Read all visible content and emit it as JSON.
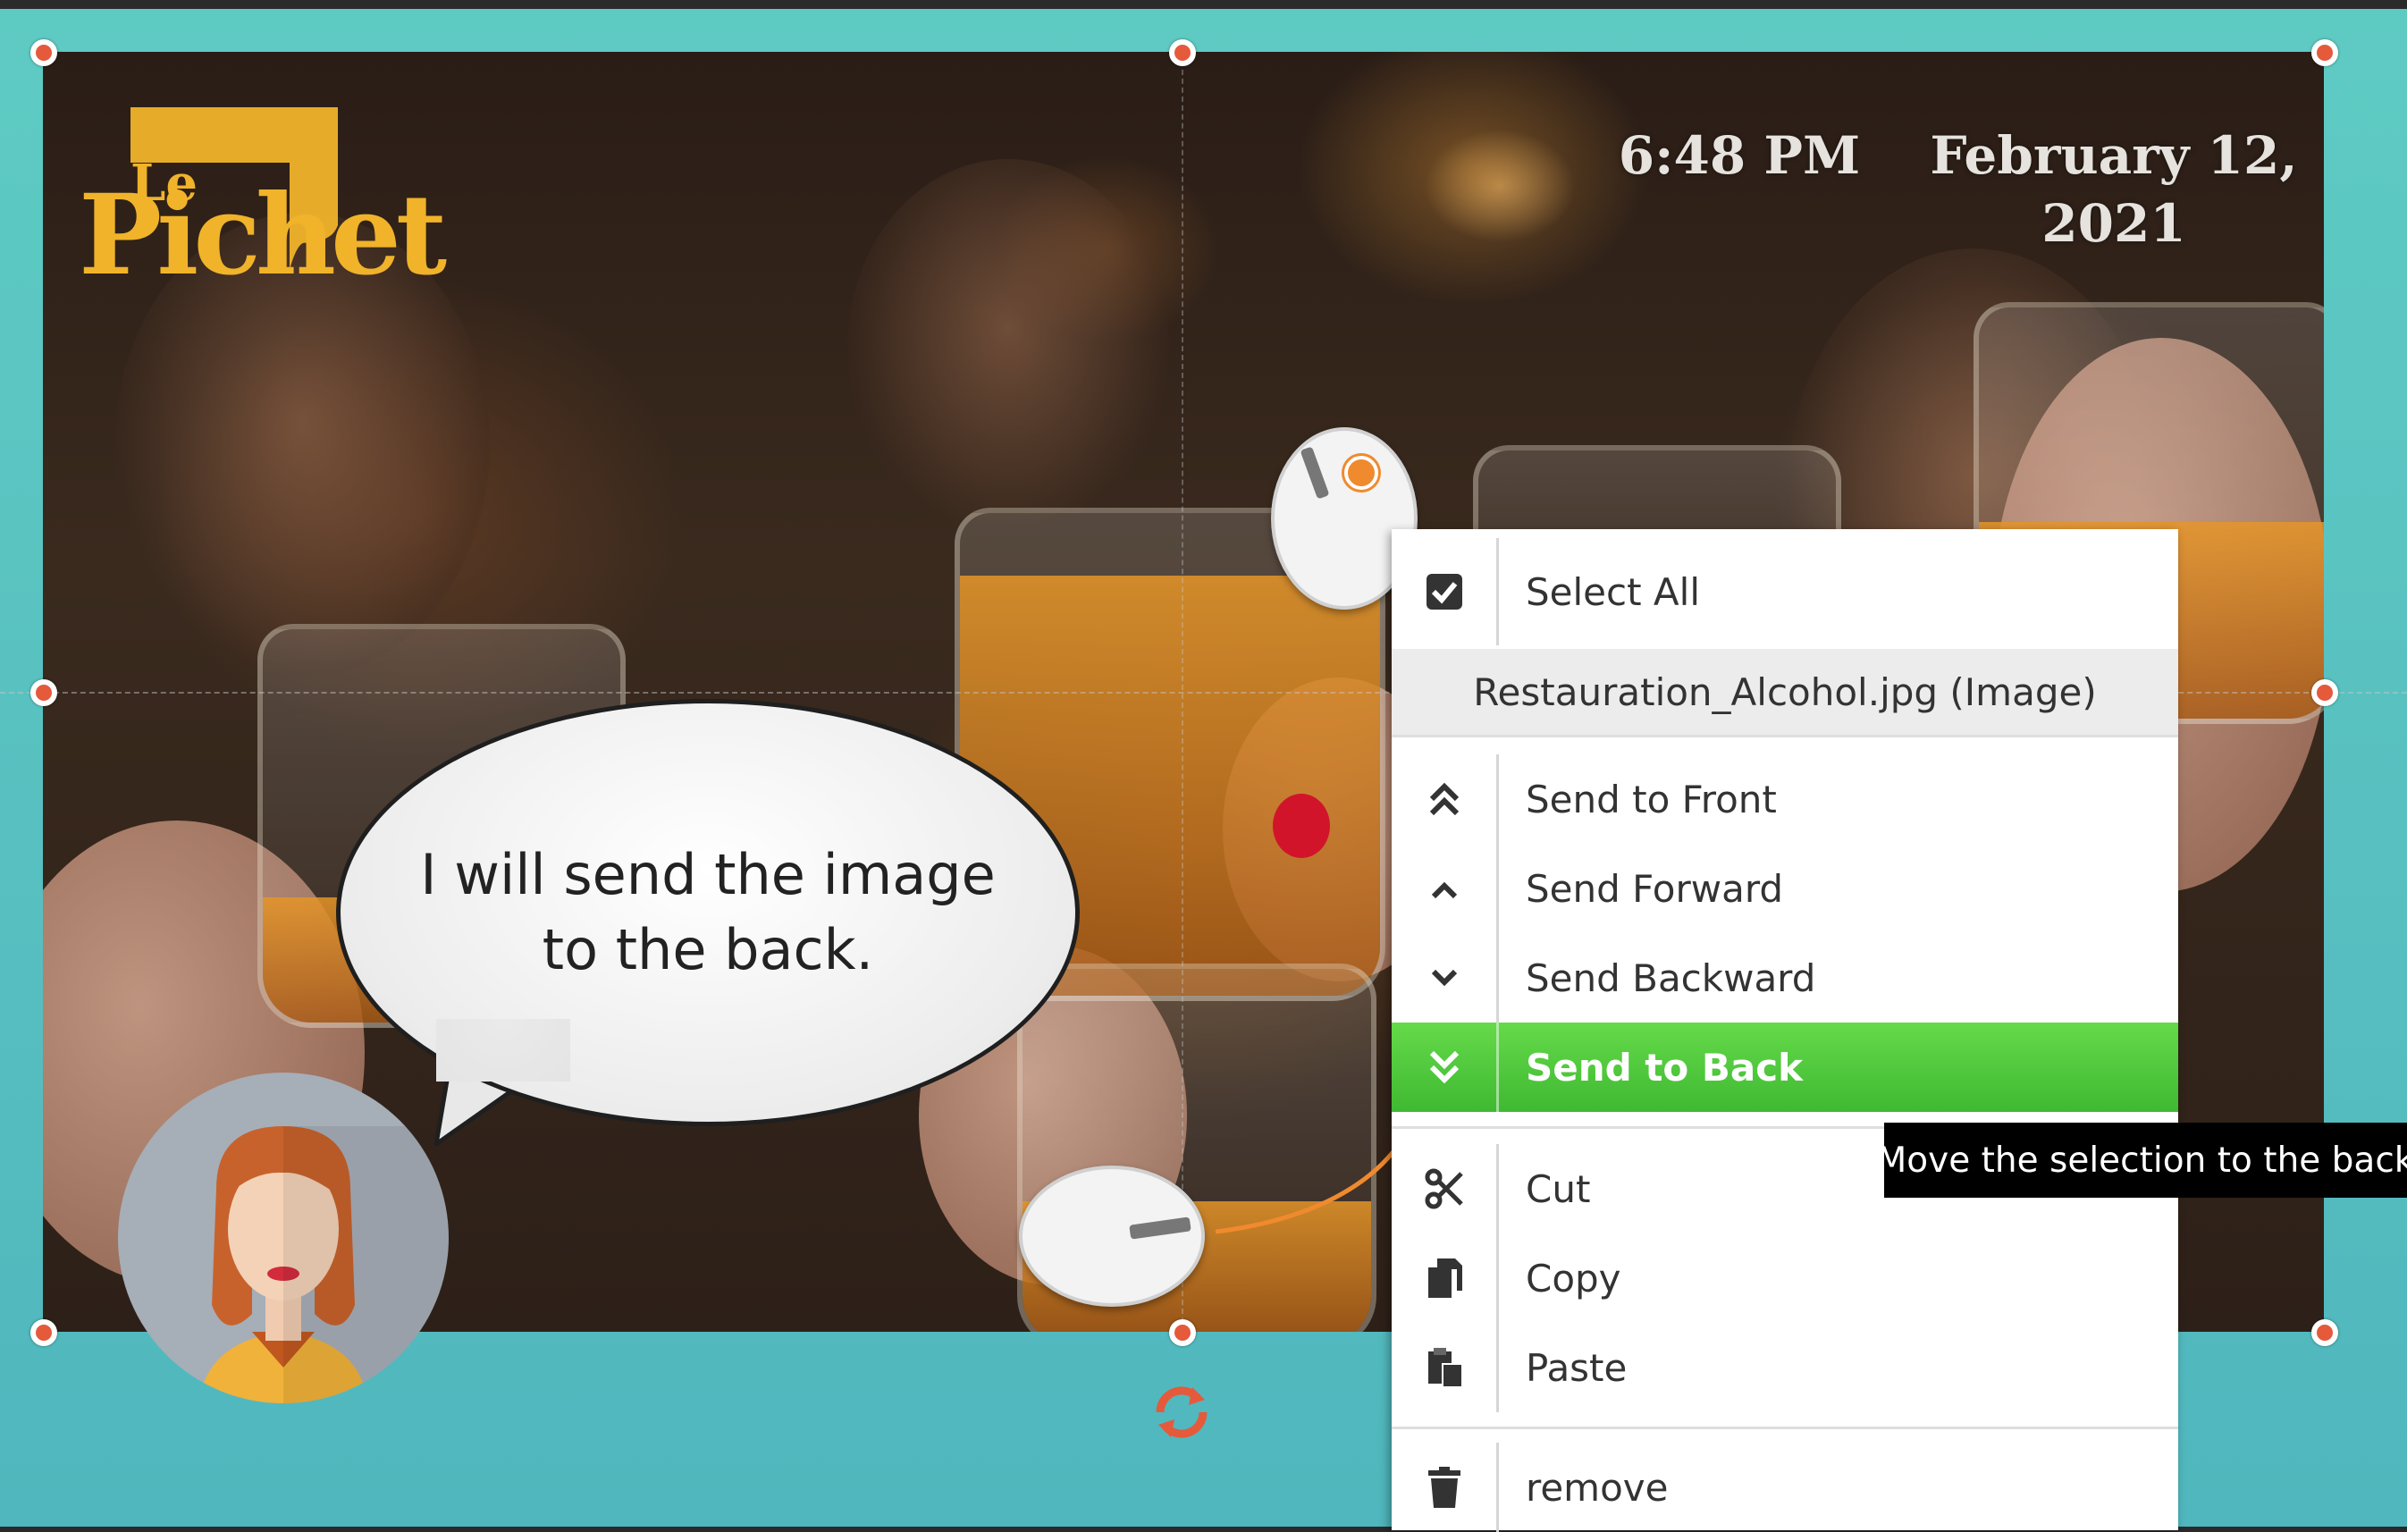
{
  "logo": {
    "prefix": "Le",
    "name": "Pichet"
  },
  "clock": {
    "time": "6:48 PM",
    "date_line1": "February 12,",
    "date_line2": "2021"
  },
  "bubble": {
    "text": "I will send the image to the back."
  },
  "menu": {
    "select_all": "Select All",
    "header": "Restauration_Alcohol.jpg (Image)",
    "send_to_front": "Send to Front",
    "send_forward": "Send Forward",
    "send_backward": "Send Backward",
    "send_to_back": "Send to Back",
    "cut": "Cut",
    "copy": "Copy",
    "paste": "Paste",
    "remove": "remove"
  },
  "tooltip": {
    "text": "Move the selection to the back"
  },
  "colors": {
    "accent_green": "#4fc83a",
    "handle": "#e45a3b",
    "canvas": "#5ecbc3",
    "logo": "#f0b32a"
  },
  "icons": {
    "select_all": "checkbox-icon",
    "send_to_front": "double-chevron-up-icon",
    "send_forward": "chevron-up-icon",
    "send_backward": "chevron-down-icon",
    "send_to_back": "double-chevron-down-icon",
    "cut": "scissors-icon",
    "copy": "copy-icon",
    "paste": "paste-icon",
    "remove": "trash-icon"
  }
}
